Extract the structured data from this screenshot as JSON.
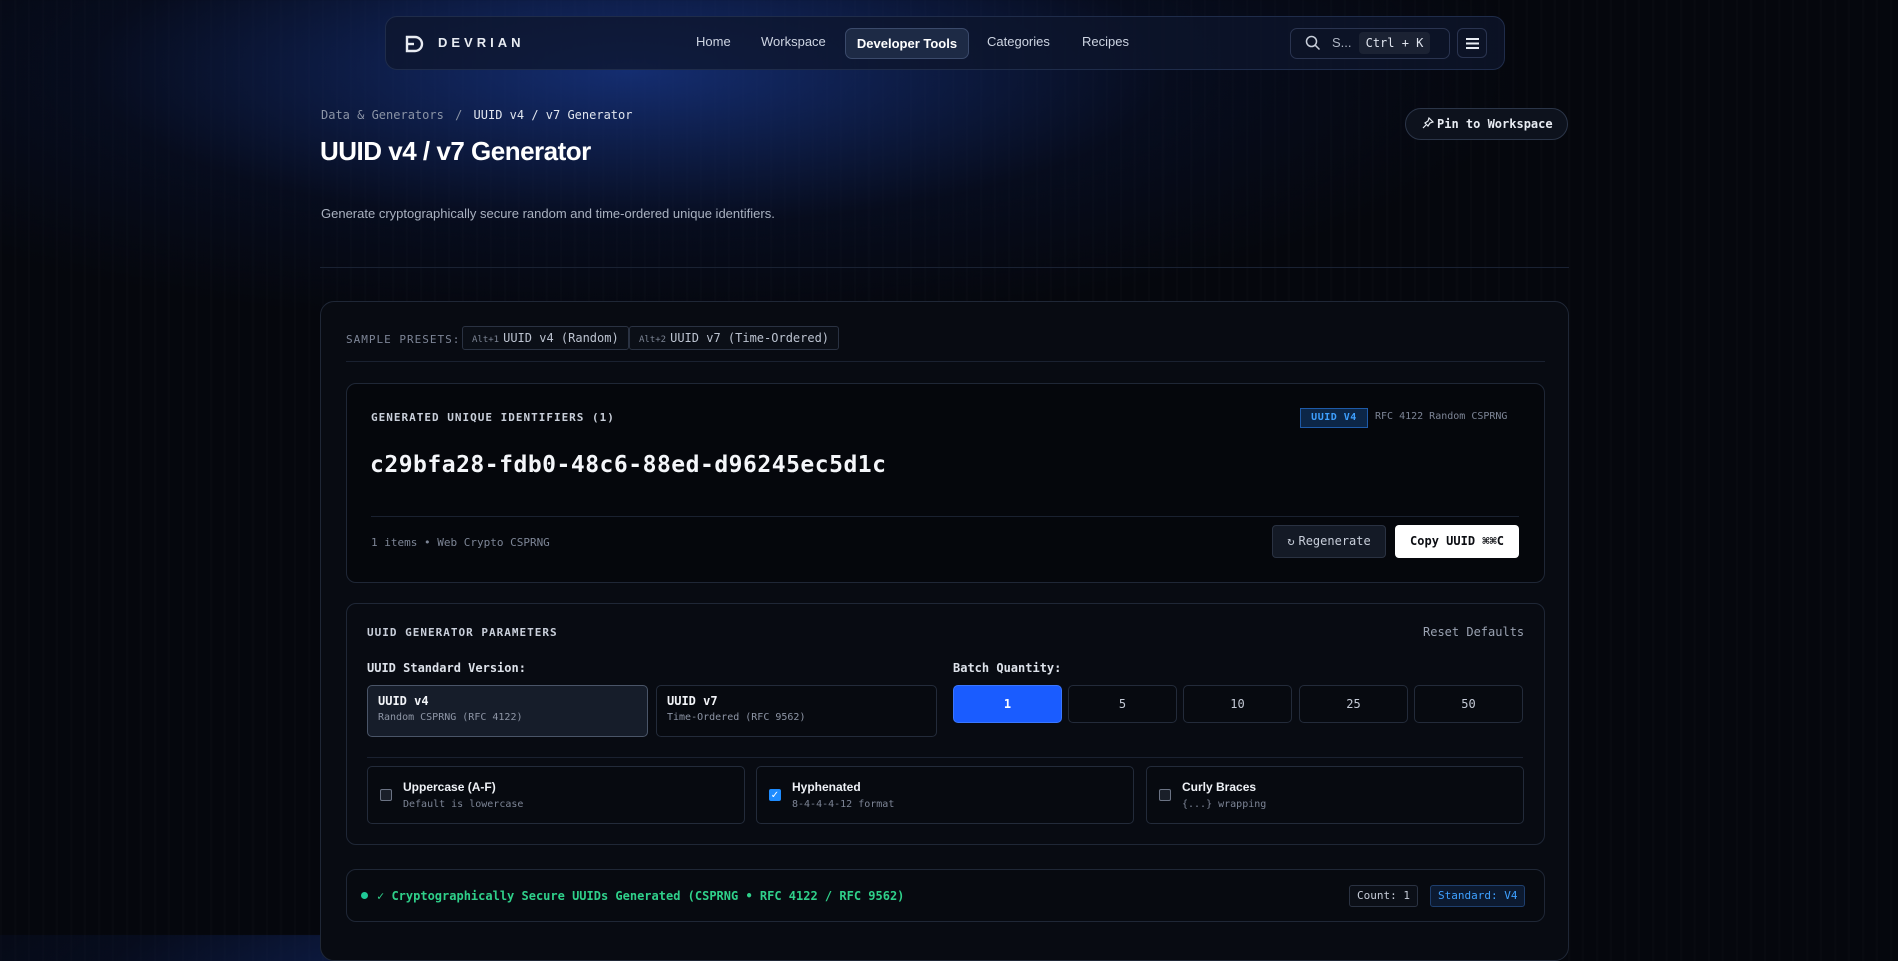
{
  "nav": {
    "brand": "DEVRIAN",
    "links": [
      "Home",
      "Workspace",
      "Developer Tools",
      "Categories",
      "Recipes"
    ],
    "active": "Developer Tools",
    "search_label": "S...",
    "shortcut": "Ctrl + K"
  },
  "header": {
    "breadcrumb_parent": "Data & Generators",
    "breadcrumb_sep": "/",
    "breadcrumb_current": "UUID v4 / v7 Generator",
    "title": "UUID v4 / v7 Generator",
    "subtitle": "Generate cryptographically secure random and time-ordered unique identifiers.",
    "pin_label": "Pin to Workspace"
  },
  "presets": {
    "label": "SAMPLE PRESETS:",
    "items": [
      {
        "key": "Alt+1",
        "label": "UUID v4 (Random)"
      },
      {
        "key": "Alt+2",
        "label": "UUID v7 (Time-Ordered)"
      }
    ]
  },
  "output": {
    "label": "GENERATED UNIQUE IDENTIFIERS (1)",
    "badge": "UUID V4",
    "badge_desc": "RFC 4122 Random CSPRNG",
    "uuid": "c29bfa28-fdb0-48c6-88ed-d96245ec5d1c",
    "meta": "1 items • Web Crypto CSPRNG",
    "regenerate_label": "Regenerate",
    "copy_label": "Copy UUID ⌘⌘C"
  },
  "params": {
    "label": "UUID GENERATOR PARAMETERS",
    "reset_label": "Reset Defaults",
    "version_label": "UUID Standard Version:",
    "versions": [
      {
        "title": "UUID v4",
        "desc": "Random CSPRNG (RFC 4122)",
        "selected": true
      },
      {
        "title": "UUID v7",
        "desc": "Time-Ordered (RFC 9562)",
        "selected": false
      }
    ],
    "batch_label": "Batch Quantity:",
    "batch_options": [
      "1",
      "5",
      "10",
      "25",
      "50"
    ],
    "batch_selected": "1",
    "options": [
      {
        "title": "Uppercase (A-F)",
        "desc": "Default is lowercase",
        "checked": false
      },
      {
        "title": "Hyphenated",
        "desc": "8-4-4-4-12 format",
        "checked": true
      },
      {
        "title": "Curly Braces",
        "desc": "{...} wrapping",
        "checked": false
      }
    ]
  },
  "status": {
    "message": "✓ Cryptographically Secure UUIDs Generated (CSPRNG • RFC 4122 / RFC 9562)",
    "count": "Count: 1",
    "standard": "Standard: V4"
  },
  "colors": {
    "accent": "#1a5cff",
    "success": "#2fd08a",
    "badge": "#3ea0ff"
  }
}
